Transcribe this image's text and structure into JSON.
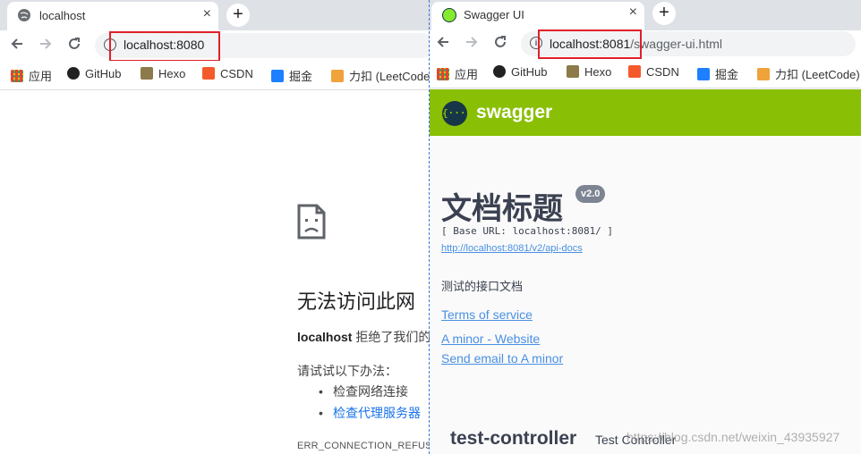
{
  "left_window": {
    "tab_title": "localhost",
    "tab_close": "×",
    "new_tab": "+",
    "address": {
      "host": "localhost:8080",
      "path": ""
    },
    "bookmarks": [
      {
        "label": "应用",
        "icon": "apps-grid-icon"
      },
      {
        "label": "GitHub",
        "icon": "github-icon"
      },
      {
        "label": "Hexo",
        "icon": "hexo-icon"
      },
      {
        "label": "CSDN",
        "icon": "csdn-icon"
      },
      {
        "label": "掘金",
        "icon": "juejin-icon"
      },
      {
        "label": "力扣 (LeetCode)",
        "icon": "leetcode-icon"
      }
    ],
    "error": {
      "title": "无法访问此网",
      "desc_host": "localhost",
      "desc_rest": " 拒绝了我们的",
      "try_label": "请试试以下办法：",
      "suggestions": [
        "检查网络连接",
        "检查代理服务器"
      ],
      "code": "ERR_CONNECTION_REFUSE"
    }
  },
  "right_window": {
    "tab_title": "Swagger UI",
    "tab_close": "×",
    "new_tab": "+",
    "address": {
      "host": "localhost:8081",
      "path": "/swagger-ui.html"
    },
    "bookmarks": [
      {
        "label": "应用",
        "icon": "apps-grid-icon"
      },
      {
        "label": "GitHub",
        "icon": "github-icon"
      },
      {
        "label": "Hexo",
        "icon": "hexo-icon"
      },
      {
        "label": "CSDN",
        "icon": "csdn-icon"
      },
      {
        "label": "掘金",
        "icon": "juejin-icon"
      },
      {
        "label": "力扣 (LeetCode)",
        "icon": "leetcode-icon"
      }
    ],
    "swagger": {
      "logo_glyph": "{···}",
      "brand": "swagger",
      "title": "文档标题",
      "version": "v2.0",
      "base_url": "[ Base URL: localhost:8081/ ]",
      "api_docs": "http://localhost:8081/v2/api-docs",
      "description": "测试的接口文档",
      "terms": "Terms of service",
      "contact_website": "A minor - Website",
      "contact_email": "Send email to A minor",
      "section_title": "test-controller",
      "section_desc": "Test Controller"
    }
  },
  "watermark": "https://blog.csdn.net/weixin_43935927",
  "colors": {
    "swagger_green": "#89bf04",
    "link_blue": "#4990e2",
    "highlight_red": "#e0202a",
    "tabstrip_gray": "#dee1e6",
    "text_dark": "#3b4151"
  }
}
